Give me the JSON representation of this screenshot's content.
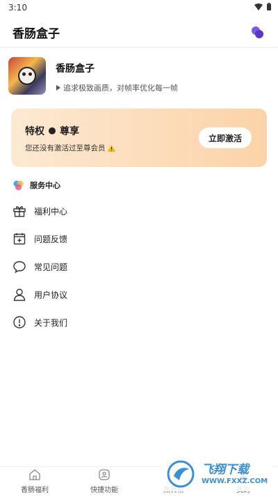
{
  "status_bar": {
    "time": "3:10"
  },
  "header": {
    "title": "香肠盒子"
  },
  "profile": {
    "name": "香肠盒子",
    "tagline": "追求极致画质，对帧率优化每一帧"
  },
  "vip": {
    "title": "特权",
    "level": "尊享",
    "subtitle": "您还没有激活过至尊会员",
    "button": "立即激活"
  },
  "service": {
    "title": "服务中心"
  },
  "menu": [
    {
      "label": "福利中心",
      "icon": "gift-icon"
    },
    {
      "label": "问题反馈",
      "icon": "calendar-plus-icon"
    },
    {
      "label": "常见问题",
      "icon": "chat-bubble-icon"
    },
    {
      "label": "用户协议",
      "icon": "user-icon"
    },
    {
      "label": "关于我们",
      "icon": "info-icon"
    }
  ],
  "tabbar": [
    {
      "label": "香肠福利",
      "icon": "home-icon"
    },
    {
      "label": "快捷功能",
      "icon": "gamepad-icon"
    },
    {
      "label": "热转榜",
      "icon": "chart-icon"
    },
    {
      "label": "我的",
      "icon": "profile-icon"
    }
  ],
  "watermark": {
    "brand": "飞翔下载",
    "url": "WWW.FXXZ.COM"
  },
  "colors": {
    "accent": "#6d4ad6",
    "vip_gradient_start": "#fde9d2",
    "vip_gradient_end": "#fbd3a8"
  }
}
